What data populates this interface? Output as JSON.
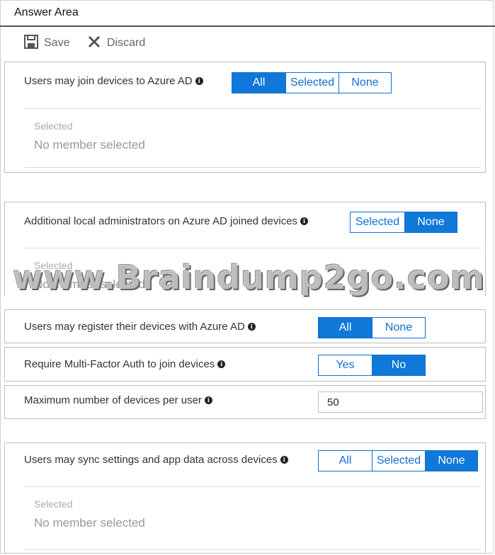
{
  "header": {
    "title": "Answer Area"
  },
  "toolbar": {
    "save_label": "Save",
    "discard_label": "Discard"
  },
  "join_devices": {
    "label": "Users may join devices to Azure AD",
    "options": [
      "All",
      "Selected",
      "None"
    ],
    "selected": "All",
    "selected_caption": "Selected",
    "selected_value": "No member selected"
  },
  "local_admins": {
    "label": "Additional local administrators on Azure AD joined devices",
    "options": [
      "Selected",
      "None"
    ],
    "selected": "None",
    "selected_caption": "Selected",
    "selected_value": "No member selected"
  },
  "watermark": "www.Braindump2go.com",
  "register_devices": {
    "label": "Users may register their devices with Azure AD",
    "options": [
      "All",
      "None"
    ],
    "selected": "All"
  },
  "mfa": {
    "label": "Require Multi-Factor Auth to join devices",
    "options": [
      "Yes",
      "No"
    ],
    "selected": "No"
  },
  "max_devices": {
    "label": "Maximum number of devices per user",
    "value": "50"
  },
  "sync_settings": {
    "label": "Users may sync settings and app data across devices",
    "options": [
      "All",
      "Selected",
      "None"
    ],
    "selected": "None",
    "selected_caption": "Selected",
    "selected_value": "No member selected"
  },
  "colors": {
    "accent": "#0f78d8",
    "border": "#bdbdbd"
  },
  "icons": {
    "save": "floppy-disk-icon",
    "discard": "x-icon",
    "info": "info-icon"
  }
}
